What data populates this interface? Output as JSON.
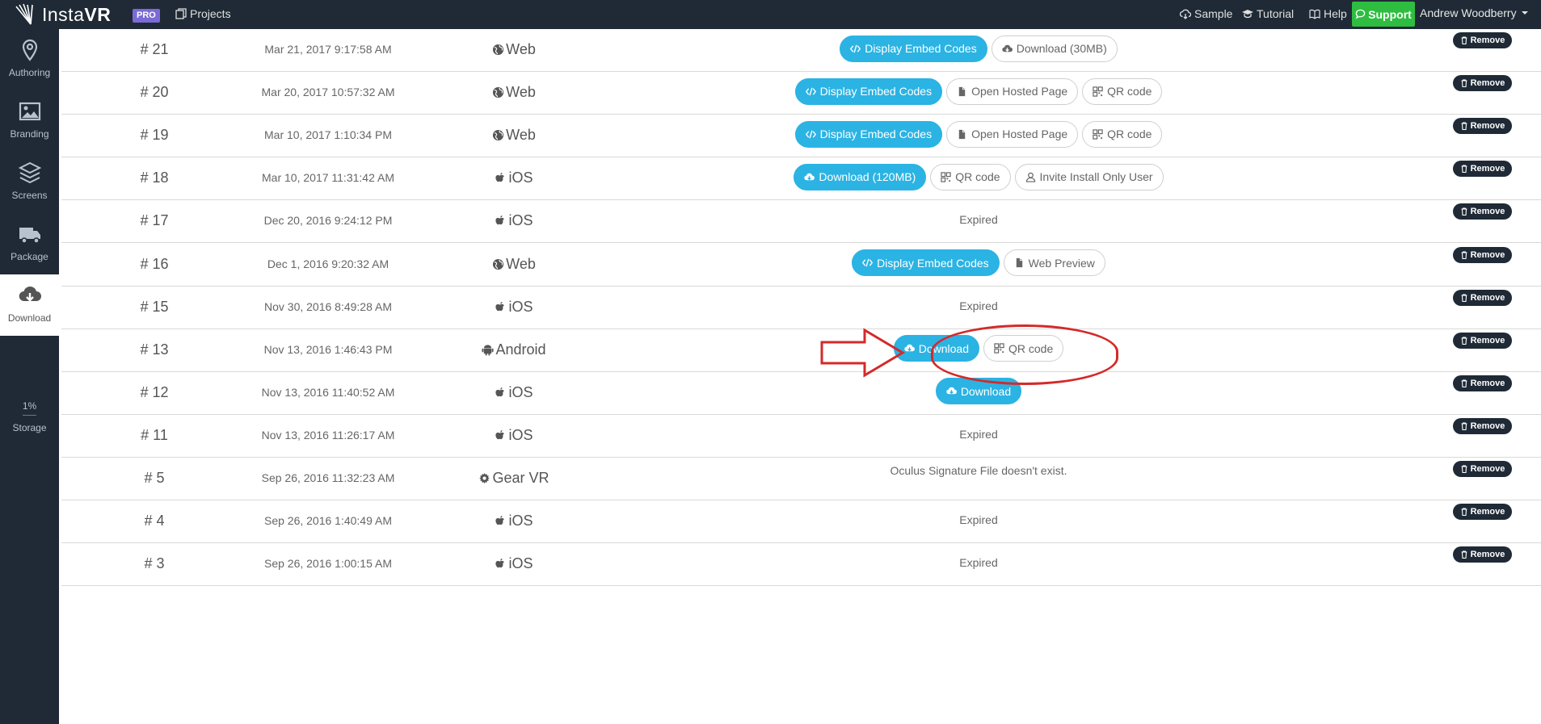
{
  "topbar": {
    "logo_text_light": "Insta",
    "logo_text_bold": "VR",
    "pro_badge": "PRO",
    "projects_label": "Projects",
    "sample_label": "Sample",
    "tutorial_label": "Tutorial",
    "help_label": "Help",
    "support_label": "Support",
    "user_name": "Andrew Woodberry"
  },
  "sidebar": {
    "items": [
      {
        "label": "Authoring",
        "icon": "map-pin-icon"
      },
      {
        "label": "Branding",
        "icon": "image-icon"
      },
      {
        "label": "Screens",
        "icon": "layers-icon"
      },
      {
        "label": "Package",
        "icon": "truck-icon"
      },
      {
        "label": "Download",
        "icon": "cloud-download-icon"
      }
    ],
    "storage_pct": "1%",
    "storage_label": "Storage"
  },
  "remove_label": "Remove",
  "rows": [
    {
      "num": "# 21",
      "date": "Mar 21, 2017 9:17:58 AM",
      "platform": "Web",
      "icon": "globe",
      "actions": [
        {
          "type": "blue",
          "icon": "code",
          "label": "Display Embed Codes"
        },
        {
          "type": "white",
          "icon": "cloud",
          "label": "Download (30MB)"
        }
      ]
    },
    {
      "num": "# 20",
      "date": "Mar 20, 2017 10:57:32 AM",
      "platform": "Web",
      "icon": "globe",
      "actions": [
        {
          "type": "blue",
          "icon": "code",
          "label": "Display Embed Codes"
        },
        {
          "type": "white",
          "icon": "file",
          "label": "Open Hosted Page"
        },
        {
          "type": "white",
          "icon": "qr",
          "label": "QR code"
        }
      ]
    },
    {
      "num": "# 19",
      "date": "Mar 10, 2017 1:10:34 PM",
      "platform": "Web",
      "icon": "globe",
      "actions": [
        {
          "type": "blue",
          "icon": "code",
          "label": "Display Embed Codes"
        },
        {
          "type": "white",
          "icon": "file",
          "label": "Open Hosted Page"
        },
        {
          "type": "white",
          "icon": "qr",
          "label": "QR code"
        }
      ]
    },
    {
      "num": "# 18",
      "date": "Mar 10, 2017 11:31:42 AM",
      "platform": "iOS",
      "icon": "apple",
      "actions": [
        {
          "type": "blue",
          "icon": "cloud",
          "label": "Download (120MB)"
        },
        {
          "type": "white",
          "icon": "qr",
          "label": "QR code"
        },
        {
          "type": "white",
          "icon": "user",
          "label": "Invite Install Only User"
        }
      ]
    },
    {
      "num": "# 17",
      "date": "Dec 20, 2016 9:24:12 PM",
      "platform": "iOS",
      "icon": "apple",
      "status": "Expired",
      "actions": []
    },
    {
      "num": "# 16",
      "date": "Dec 1, 2016 9:20:32 AM",
      "platform": "Web",
      "icon": "globe",
      "actions": [
        {
          "type": "blue",
          "icon": "code",
          "label": "Display Embed Codes"
        },
        {
          "type": "white",
          "icon": "file",
          "label": "Web Preview"
        }
      ]
    },
    {
      "num": "# 15",
      "date": "Nov 30, 2016 8:49:28 AM",
      "platform": "iOS",
      "icon": "apple",
      "status": "Expired",
      "actions": []
    },
    {
      "num": "# 13",
      "date": "Nov 13, 2016 1:46:43 PM",
      "platform": "Android",
      "icon": "android",
      "actions": [
        {
          "type": "blue",
          "icon": "cloud",
          "label": "Download"
        },
        {
          "type": "white",
          "icon": "qr",
          "label": "QR code"
        }
      ]
    },
    {
      "num": "# 12",
      "date": "Nov 13, 2016 11:40:52 AM",
      "platform": "iOS",
      "icon": "apple",
      "actions": [
        {
          "type": "blue",
          "icon": "cloud",
          "label": "Download"
        }
      ]
    },
    {
      "num": "# 11",
      "date": "Nov 13, 2016 11:26:17 AM",
      "platform": "iOS",
      "icon": "apple",
      "status": "Expired",
      "actions": []
    },
    {
      "num": "# 5",
      "date": "Sep 26, 2016 11:32:23 AM",
      "platform": "Gear VR",
      "icon": "gear",
      "status": "Oculus Signature File doesn't exist.",
      "actions": []
    },
    {
      "num": "# 4",
      "date": "Sep 26, 2016 1:40:49 AM",
      "platform": "iOS",
      "icon": "apple",
      "status": "Expired",
      "actions": []
    },
    {
      "num": "# 3",
      "date": "Sep 26, 2016 1:00:15 AM",
      "platform": "iOS",
      "icon": "apple",
      "status": "Expired",
      "actions": []
    }
  ],
  "colors": {
    "navbar": "#1f2a36",
    "accent_blue": "#2bb3e3",
    "support_green": "#2ebd40",
    "pro_purple": "#7a6bd6",
    "annotation_red": "#d42a2a"
  }
}
